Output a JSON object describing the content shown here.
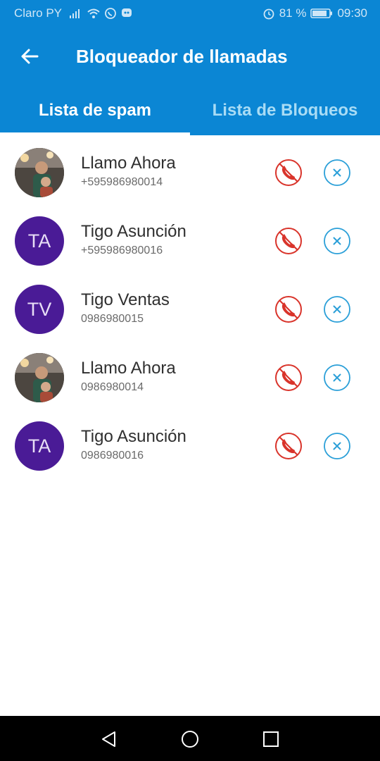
{
  "status": {
    "carrier": "Claro PY",
    "battery": "81 %",
    "time": "09:30"
  },
  "appbar": {
    "title": "Bloqueador de llamadas",
    "back_icon": "arrow-left-icon"
  },
  "tabs": [
    {
      "label": "Lista de spam",
      "active": true
    },
    {
      "label": "Lista de Bloqueos",
      "active": false
    }
  ],
  "contacts": [
    {
      "name": "Llamo Ahora",
      "phone": "+595986980014",
      "avatar": "photo"
    },
    {
      "name": "Tigo Asunción",
      "phone": "+595986980016",
      "avatar": "TA"
    },
    {
      "name": "Tigo Ventas",
      "phone": "0986980015",
      "avatar": "TV"
    },
    {
      "name": "Llamo Ahora",
      "phone": "0986980014",
      "avatar": "photo"
    },
    {
      "name": "Tigo Asunción",
      "phone": "0986980016",
      "avatar": "TA"
    }
  ],
  "colors": {
    "primary": "#0b86d4",
    "avatar_bg": "#4a1b96",
    "block_red": "#d9342b",
    "remove_blue": "#2a9fd8"
  }
}
